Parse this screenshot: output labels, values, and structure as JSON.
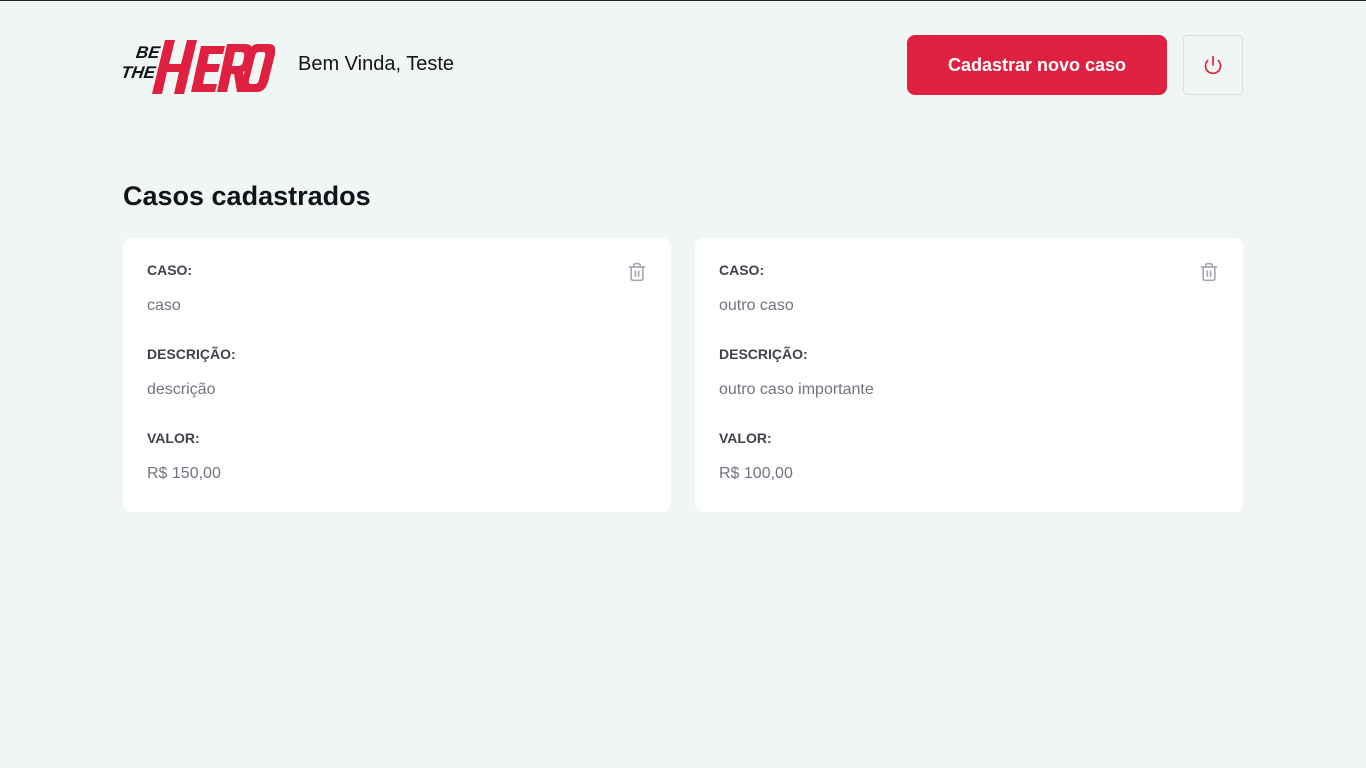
{
  "header": {
    "logo_text": "BE THE HERO",
    "greeting": "Bem Vinda, Teste",
    "new_case_label": "Cadastrar novo caso",
    "logout_icon": "power-icon"
  },
  "main": {
    "title": "Casos cadastrados",
    "cases": [
      {
        "case_label": "CASO:",
        "case_value": "caso",
        "description_label": "DESCRIÇÃO:",
        "description_value": "descrição",
        "value_label": "VALOR:",
        "value_value": "R$ 150,00"
      },
      {
        "case_label": "CASO:",
        "case_value": "outro caso",
        "description_label": "DESCRIÇÃO:",
        "description_value": "outro caso importante",
        "value_label": "VALOR:",
        "value_value": "R$ 100,00"
      }
    ]
  },
  "colors": {
    "brand": "#e02041",
    "background": "#f0f6f4",
    "card": "#ffffff",
    "text_dark": "#13131a",
    "label": "#41414d",
    "muted": "#737380"
  }
}
